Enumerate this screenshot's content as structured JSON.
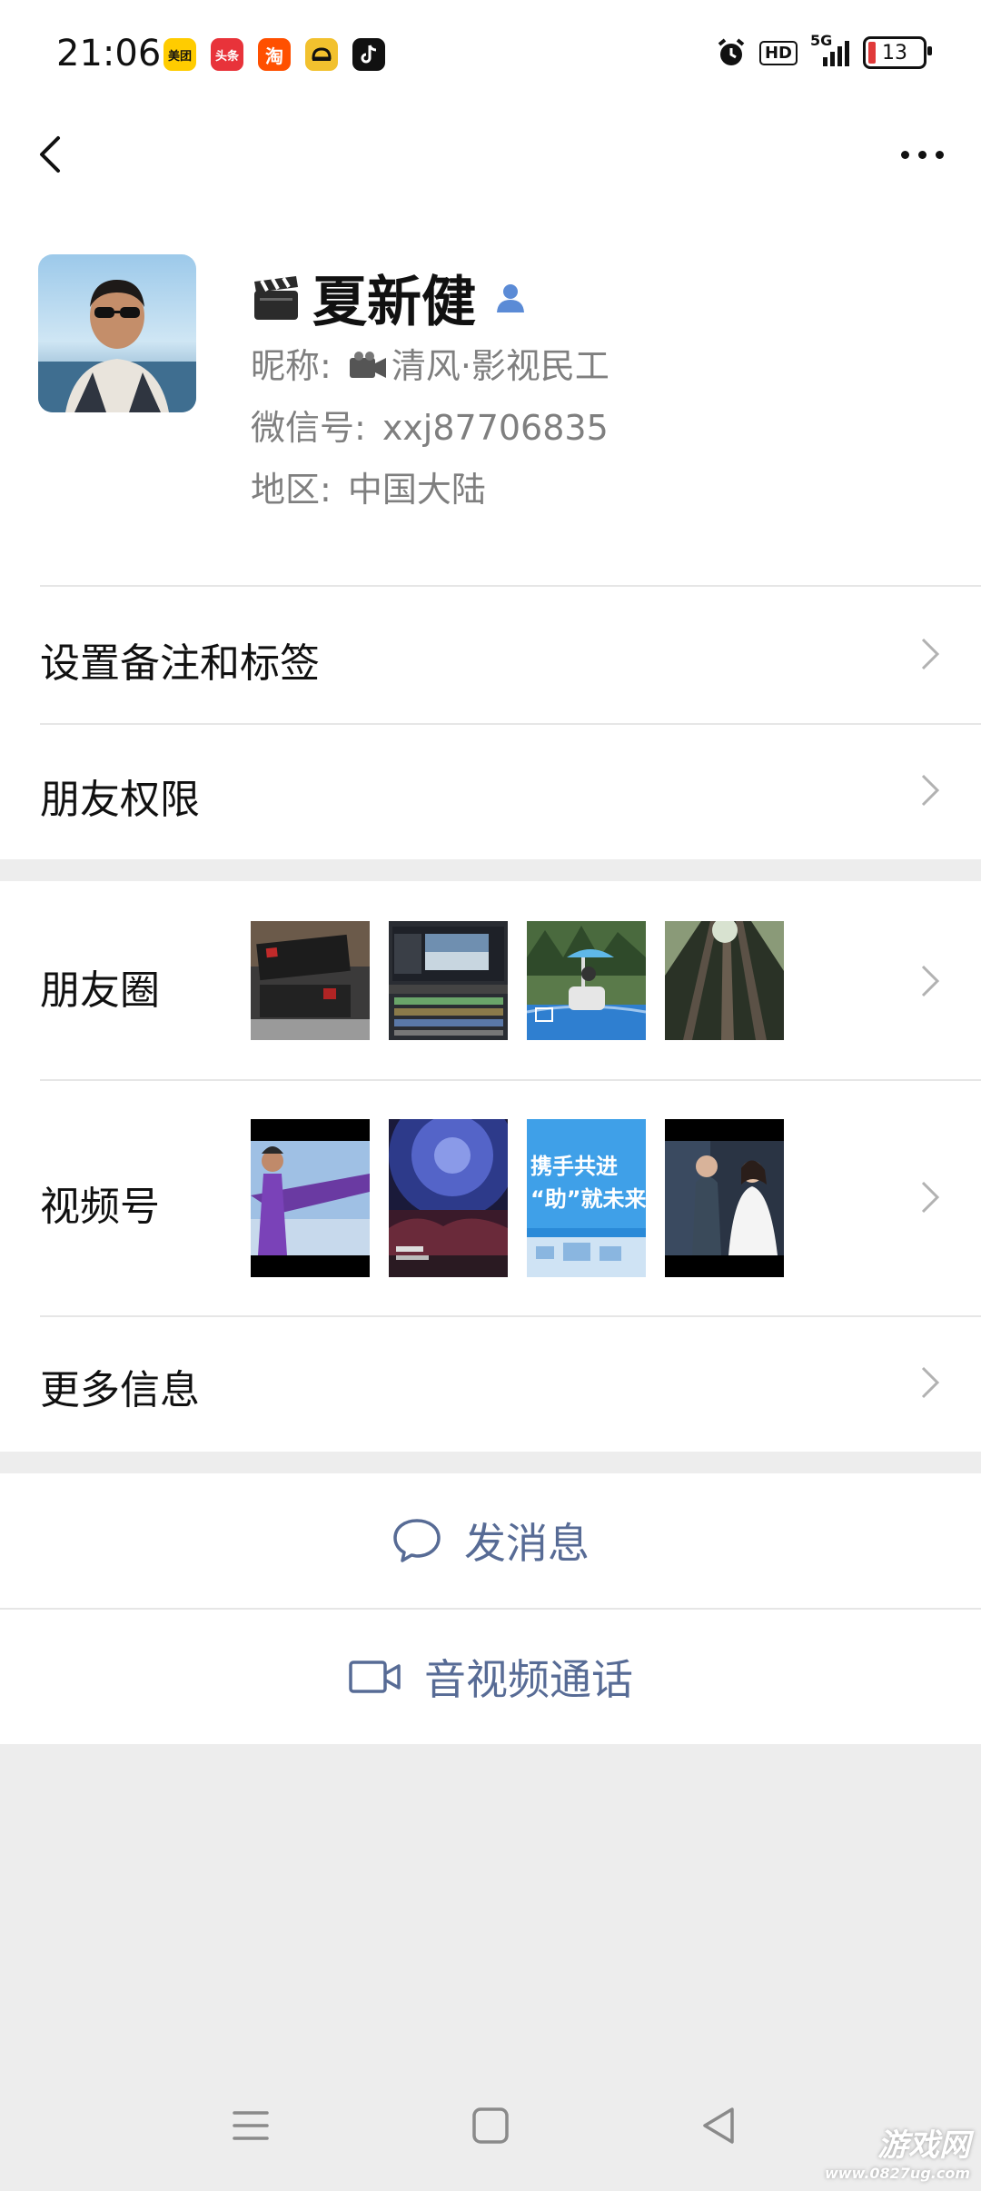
{
  "status_bar": {
    "time": "21:06",
    "app_icons": [
      {
        "name": "meituan-icon",
        "text": "美团",
        "color": "#ffcc00",
        "fg": "#111111"
      },
      {
        "name": "toutiao-icon",
        "text": "头条",
        "color": "#e8333a",
        "fg": "#ffffff"
      },
      {
        "name": "taobao-icon",
        "text": "淘",
        "color": "#ff5000",
        "fg": "#ffffff"
      },
      {
        "name": "car-app-icon",
        "text": "",
        "color": "#f2c12e",
        "fg": "#111111"
      },
      {
        "name": "tiktok-icon",
        "text": "",
        "color": "#111111",
        "fg": "#ffffff"
      }
    ],
    "hd": "HD",
    "network": "5G",
    "battery": "13"
  },
  "profile": {
    "name": "夏新健",
    "nickname_label": "昵称:",
    "nickname": "清风·影视民工",
    "wechat_id_label": "微信号:",
    "wechat_id": "xxj87706835",
    "region_label": "地区:",
    "region": "中国大陆"
  },
  "menu": {
    "remark_tags": "设置备注和标签",
    "permissions": "朋友权限",
    "moments": "朋友圈",
    "channels": "视频号",
    "more_info": "更多信息"
  },
  "actions": {
    "send_message": "发消息",
    "video_call": "音视频通话"
  },
  "thumbs": {
    "channel_3_line1": "携手共进",
    "channel_3_line2": "“助”就未来"
  },
  "watermark": {
    "line1": "游戏网",
    "line2": "www.0827ug.com"
  },
  "colors": {
    "link": "#576b95",
    "background": "#ededed",
    "divider": "#e6e6e6"
  }
}
